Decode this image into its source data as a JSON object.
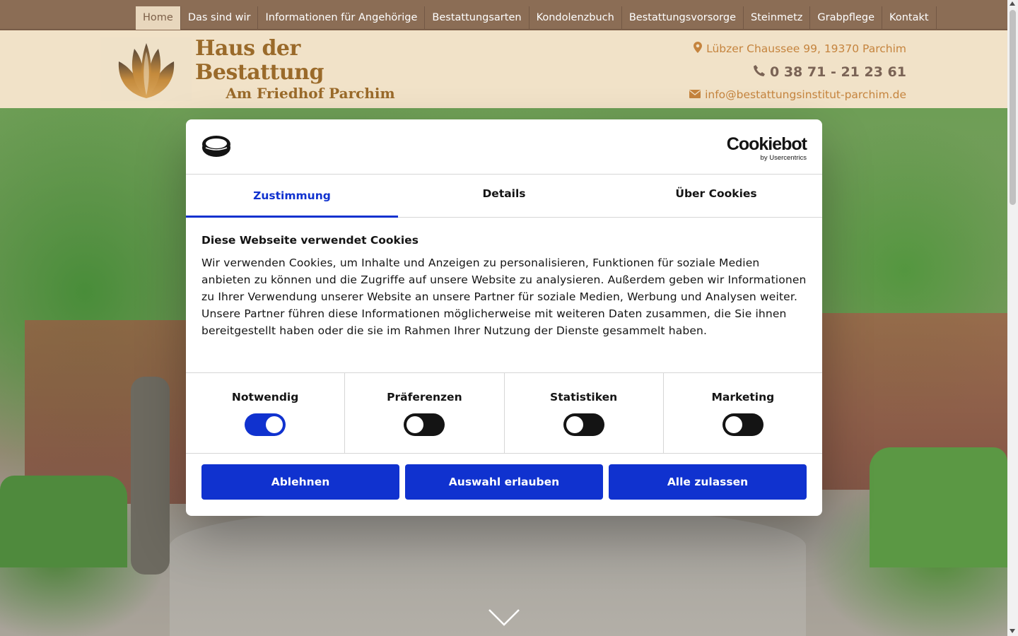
{
  "nav": {
    "items": [
      {
        "label": "Home",
        "active": true
      },
      {
        "label": "Das sind wir"
      },
      {
        "label": "Informationen für Angehörige"
      },
      {
        "label": "Bestattungsarten"
      },
      {
        "label": "Kondolenzbuch"
      },
      {
        "label": "Bestattungsvorsorge"
      },
      {
        "label": "Steinmetz"
      },
      {
        "label": "Grabpflege"
      },
      {
        "label": "Kontakt"
      }
    ]
  },
  "header": {
    "logo_title": "Haus der Bestattung",
    "logo_subtitle": "Am Friedhof Parchim",
    "address": "Lübzer Chaussee 99, 19370 Parchim",
    "phone": "0 38 71 - 21 23 61",
    "email": "info@bestattungsinstitut-parchim.de"
  },
  "cookie": {
    "brand": "Cookiebot",
    "brand_sub": "by Usercentrics",
    "tabs": [
      "Zustimmung",
      "Details",
      "Über Cookies"
    ],
    "heading": "Diese Webseite verwendet Cookies",
    "text": "Wir verwenden Cookies, um Inhalte und Anzeigen zu personalisieren, Funktionen für soziale Medien anbieten zu können und die Zugriffe auf unsere Website zu analysieren. Außerdem geben wir Informationen zu Ihrer Verwendung unserer Website an unsere Partner für soziale Medien, Werbung und Analysen weiter. Unsere Partner führen diese Informationen möglicherweise mit weiteren Daten zusammen, die Sie ihnen bereitgestellt haben oder die sie im Rahmen Ihrer Nutzung der Dienste gesammelt haben.",
    "toggles": [
      {
        "label": "Notwendig",
        "on": true
      },
      {
        "label": "Präferenzen",
        "on": false
      },
      {
        "label": "Statistiken",
        "on": false
      },
      {
        "label": "Marketing",
        "on": false
      }
    ],
    "buttons": {
      "decline": "Ablehnen",
      "allow_selection": "Auswahl erlauben",
      "allow_all": "Alle zulassen"
    }
  },
  "colors": {
    "nav_bg": "#8b6d55",
    "header_bg": "#f1e2c8",
    "accent_gold": "#c5843e",
    "cookie_blue": "#1032cf"
  },
  "icons": {
    "address": "map-marker-icon",
    "phone": "phone-icon",
    "email": "envelope-icon",
    "scroll": "chevron-down-icon"
  }
}
